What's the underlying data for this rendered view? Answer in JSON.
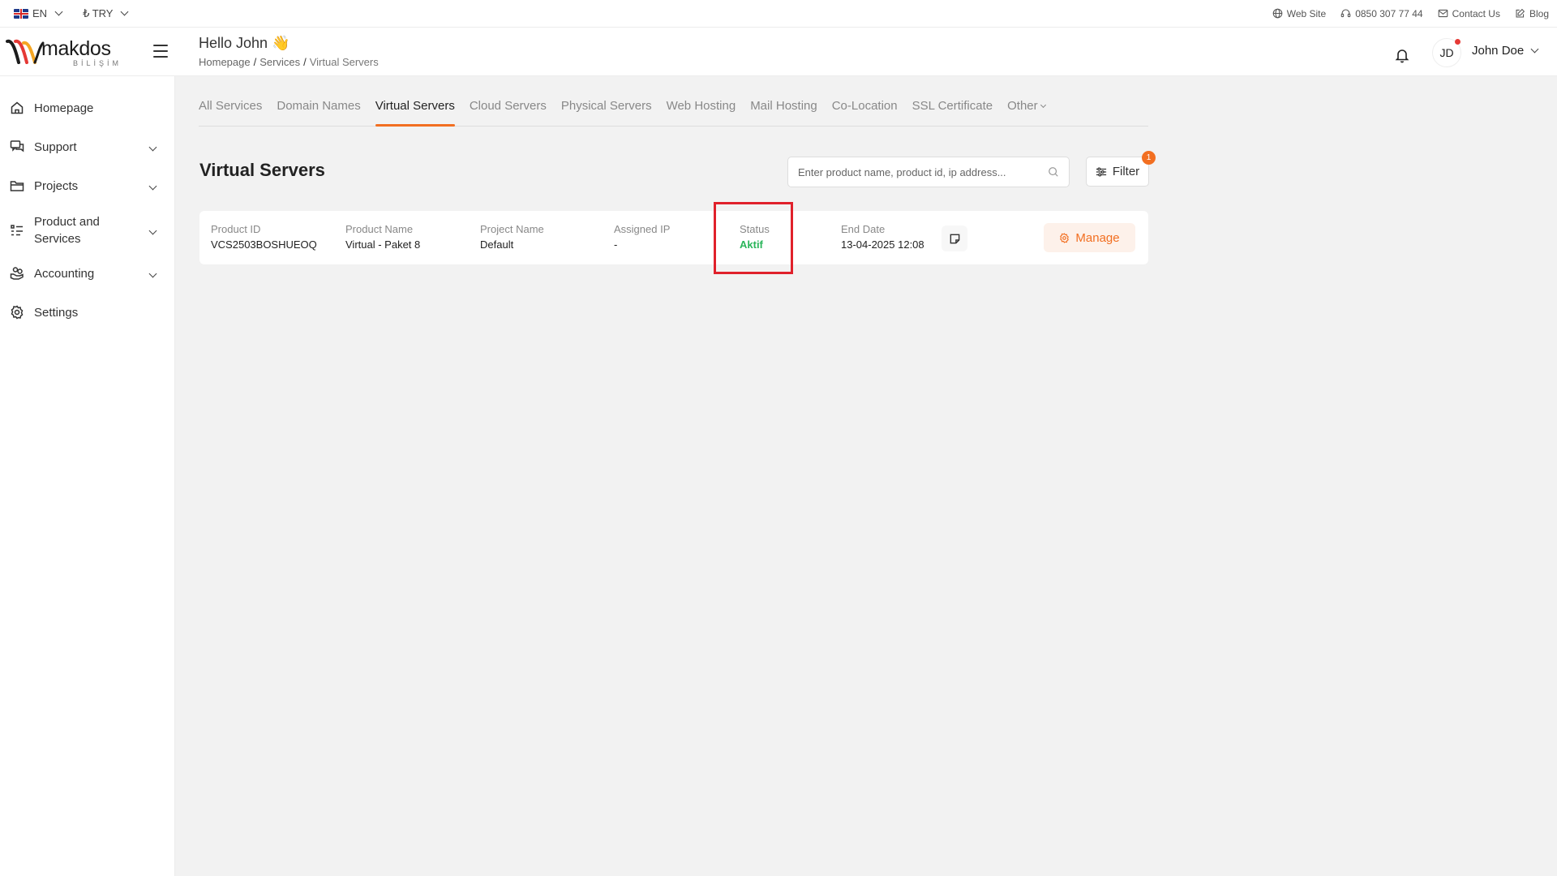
{
  "topbar": {
    "language": "EN",
    "currency": "₺ TRY",
    "links": [
      {
        "label": "Web Site",
        "icon": "globe-icon"
      },
      {
        "label": "0850 307 77 44",
        "icon": "headset-icon"
      },
      {
        "label": "Contact Us",
        "icon": "mail-icon"
      },
      {
        "label": "Blog",
        "icon": "edit-icon"
      }
    ]
  },
  "header": {
    "logo_text": "makdos",
    "logo_sub": "BİLİŞİM",
    "greeting": "Hello John 👋",
    "breadcrumb": [
      "Homepage",
      "Services",
      "Virtual Servers"
    ],
    "avatar_initials": "JD",
    "username": "John Doe"
  },
  "sidebar": {
    "items": [
      {
        "label": "Homepage",
        "icon": "home-icon",
        "expandable": false
      },
      {
        "label": "Support",
        "icon": "chat-icon",
        "expandable": true
      },
      {
        "label": "Projects",
        "icon": "folder-icon",
        "expandable": true
      },
      {
        "label": "Product and Services",
        "icon": "list-icon",
        "expandable": true
      },
      {
        "label": "Accounting",
        "icon": "coins-hand-icon",
        "expandable": true
      },
      {
        "label": "Settings",
        "icon": "gear-icon",
        "expandable": false
      }
    ]
  },
  "tabs": [
    {
      "label": "All Services",
      "active": false
    },
    {
      "label": "Domain Names",
      "active": false
    },
    {
      "label": "Virtual Servers",
      "active": true
    },
    {
      "label": "Cloud Servers",
      "active": false
    },
    {
      "label": "Physical Servers",
      "active": false
    },
    {
      "label": "Web Hosting",
      "active": false
    },
    {
      "label": "Mail Hosting",
      "active": false
    },
    {
      "label": "Co-Location",
      "active": false
    },
    {
      "label": "SSL Certificate",
      "active": false
    },
    {
      "label": "Other",
      "active": false
    }
  ],
  "main": {
    "title": "Virtual Servers",
    "search_placeholder": "Enter product name, product id, ip address...",
    "filter_label": "Filter",
    "filter_count": "1"
  },
  "service": {
    "product_id_label": "Product ID",
    "product_id": "VCS2503BOSHUEOQ",
    "product_name_label": "Product Name",
    "product_name": "Virtual - Paket 8",
    "project_name_label": "Project Name",
    "project_name": "Default",
    "assigned_ip_label": "Assigned IP",
    "assigned_ip": "-",
    "status_label": "Status",
    "status": "Aktif",
    "end_date_label": "End Date",
    "end_date": "13-04-2025 12:08",
    "manage_label": "Manage"
  },
  "colors": {
    "accent": "#f26f21",
    "status_active": "#2ab55a",
    "highlight": "#e0212b"
  }
}
